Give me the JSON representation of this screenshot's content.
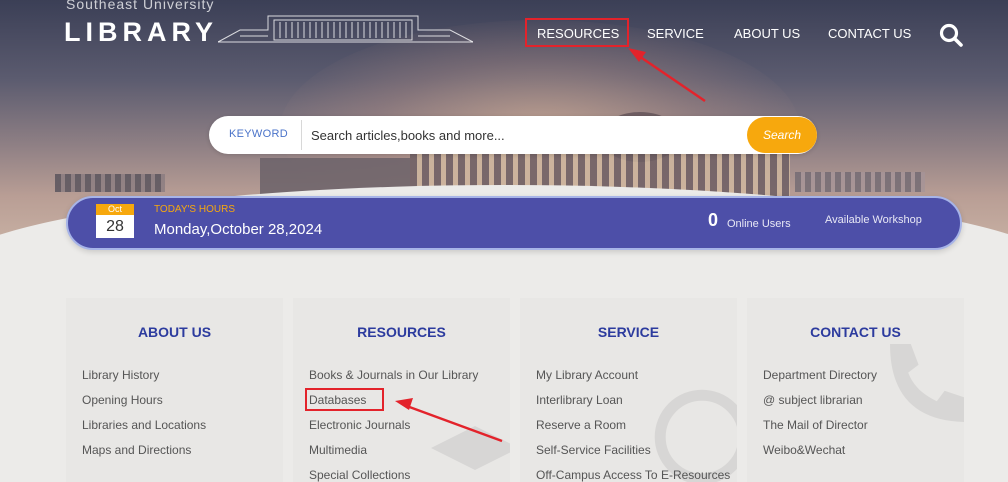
{
  "logo": {
    "subtitle": "Southeast University",
    "title": "LIBRARY"
  },
  "nav": {
    "items": [
      "RESOURCES",
      "SERVICE",
      "ABOUT US",
      "CONTACT US"
    ],
    "highlighted": "RESOURCES"
  },
  "search": {
    "keyword_label": "KEYWORD",
    "placeholder": "Search articles,books and more...",
    "button_label": "Search"
  },
  "hours": {
    "month": "Oct",
    "day": "28",
    "label": "TODAY'S HOURS",
    "date": "Monday,October 28,2024",
    "online_count": "0",
    "online_label": "Online Users",
    "workshop_label": "Available Workshop"
  },
  "columns": [
    {
      "title": "ABOUT US",
      "items": [
        "Library History",
        "Opening Hours",
        "Libraries and Locations",
        "Maps and Directions"
      ]
    },
    {
      "title": "RESOURCES",
      "items": [
        "Books & Journals in Our Library",
        "Databases",
        "Electronic Journals",
        "Multimedia",
        "Special Collections"
      ]
    },
    {
      "title": "SERVICE",
      "items": [
        "My Library Account",
        "Interlibrary Loan",
        "Reserve a Room",
        "Self-Service Facilities",
        "Off-Campus Access To E-Resources"
      ]
    },
    {
      "title": "CONTACT US",
      "items": [
        "Department Directory",
        "@ subject librarian",
        "The Mail of Director",
        "Weibo&Wechat"
      ]
    }
  ],
  "colors": {
    "accent_orange": "#f7a80d",
    "hours_bar": "#4d4fa8",
    "column_title": "#2c3b9e",
    "annotation_red": "#e3232b"
  }
}
